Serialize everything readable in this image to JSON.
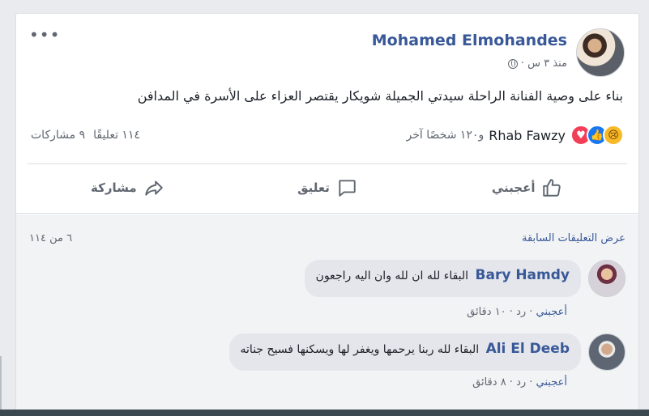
{
  "post": {
    "author": "Mohamed Elmohandes",
    "time": "منذ ٣ س ·",
    "text": "بناء على وصية الفنانة الراحلة سيدتي الجميلة شويكار يقتصر العزاء على الأسرة في المدافن",
    "more_icon": "more-options-icon",
    "privacy_icon": "globe-icon"
  },
  "reactions": {
    "icons": [
      "sad-icon",
      "like-icon",
      "love-icon"
    ],
    "name": "Rhab Fawzy",
    "others": "و١٢٠ شخصًا آخر"
  },
  "counts": {
    "comments": "١١٤ تعليقًا",
    "shares": "٩ مشاركات"
  },
  "actions": {
    "like": "أعجبني",
    "comment": "تعليق",
    "share": "مشاركة"
  },
  "comments_section": {
    "view_previous": "عرض التعليقات السابقة",
    "page_count": "٦ من ١١٤",
    "items": [
      {
        "name": "Bary Hamdy",
        "text": "البقاء لله ان لله وان اليه راجعون",
        "like": "أعجبني",
        "meta": " · رد · ١٠ دقائق"
      },
      {
        "name": "Ali El Deeb",
        "text": "البقاء لله ربنا يرحمها ويغفر لها ويسكنها فسيح جناته",
        "like": "أعجبني",
        "meta": " · رد · ٨ دقائق"
      }
    ]
  },
  "colors": {
    "link": "#385898",
    "secondary_text": "#606770",
    "background": "#e9ebee"
  }
}
